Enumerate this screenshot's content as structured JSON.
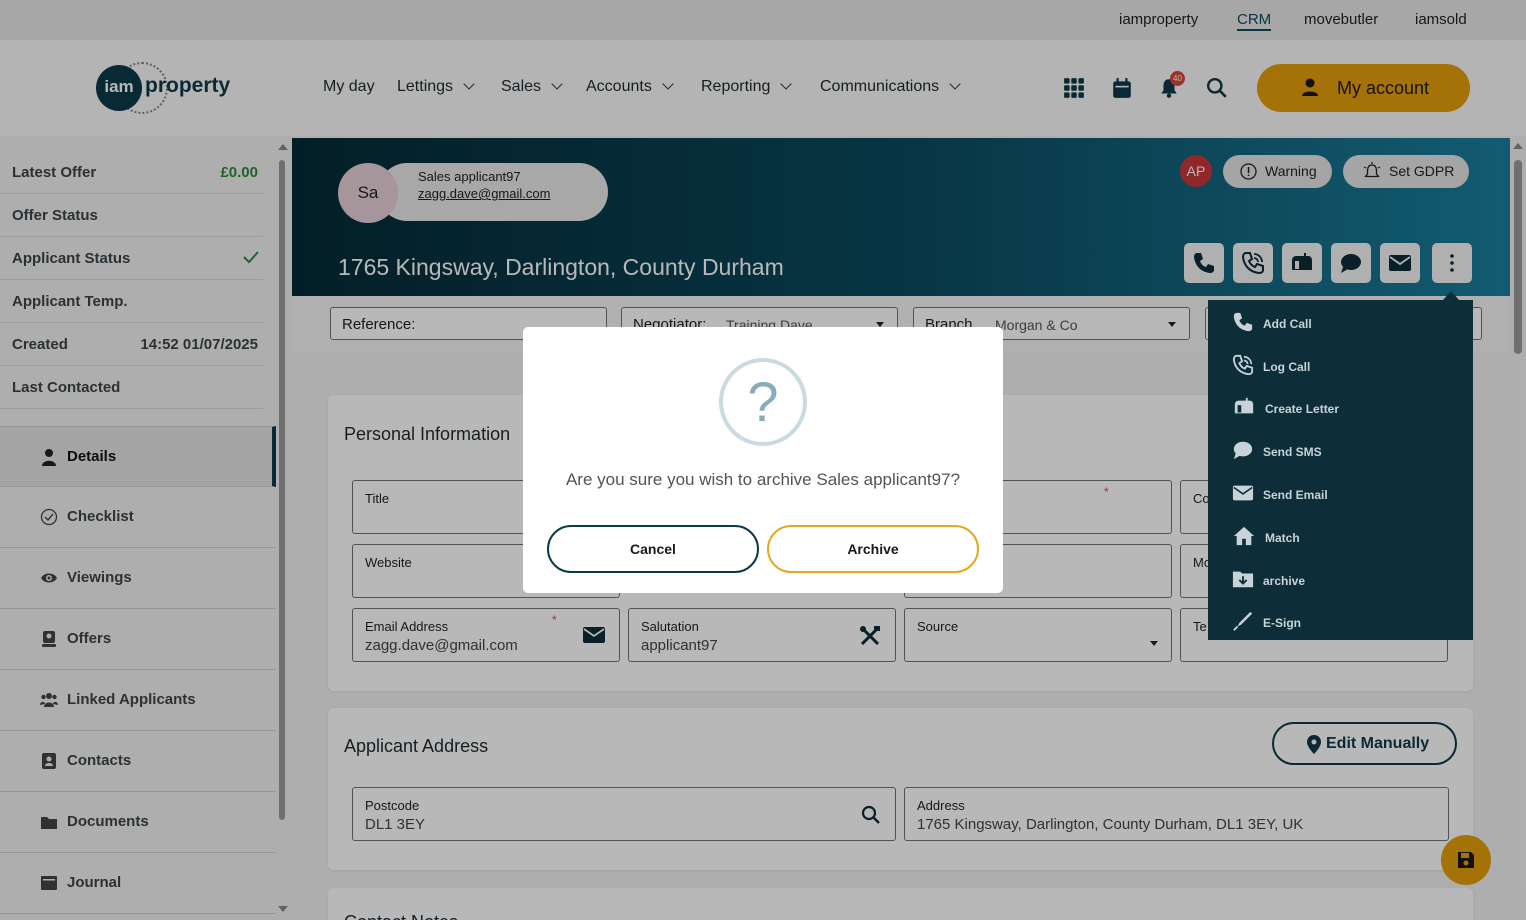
{
  "brandbar": {
    "links": [
      "iamproperty",
      "CRM",
      "movebutler",
      "iamsold"
    ],
    "active": "CRM"
  },
  "nav": {
    "logo_short": "iam",
    "logo_word": "property",
    "menu": [
      "My day",
      "Lettings",
      "Sales",
      "Accounts",
      "Reporting",
      "Communications"
    ],
    "notification_count": "40",
    "my_account_label": "My account",
    "accent_color": "#e39e0b"
  },
  "sidebar": {
    "summary": [
      {
        "label": "Latest Offer",
        "value": "£0.00"
      },
      {
        "label": "Offer Status",
        "value": ""
      },
      {
        "label": "Applicant Status",
        "value": ""
      },
      {
        "label": "Applicant Temp.",
        "value": ""
      },
      {
        "label": "Created",
        "value": "14:52 01/07/2025"
      },
      {
        "label": "Last Contacted",
        "value": ""
      }
    ],
    "tabs": [
      "Details",
      "Checklist",
      "Viewings",
      "Offers",
      "Linked Applicants",
      "Contacts",
      "Documents",
      "Journal"
    ],
    "active_tab": "Details"
  },
  "header": {
    "avatar_initials": "Sa",
    "applicant_name": "Sales applicant97",
    "applicant_email": "zagg.dave@gmail.com",
    "address": "1765 Kingsway, Darlington, County Durham",
    "user_badge": "AP",
    "warning_label": "Warning",
    "gdpr_label": "Set GDPR"
  },
  "filters": {
    "reference_label": "Reference:",
    "negotiator_label": "Negotiator:",
    "negotiator_value": "Training Dave",
    "branch_label": "Branch",
    "branch_value": "Morgan & Co"
  },
  "personal": {
    "title": "Personal Information",
    "fields": {
      "title_label": "Title",
      "website_label": "Website",
      "email_label": "Email Address",
      "email_value": "zagg.dave@gmail.com",
      "salutation_label": "Salutation",
      "salutation_value": "applicant97",
      "source_label": "Source",
      "co_label": "Co",
      "mo_label": "Mo",
      "te_label": "Te"
    }
  },
  "address_card": {
    "title": "Applicant Address",
    "edit_label": "Edit Manually",
    "postcode_label": "Postcode",
    "postcode_value": "DL1 3EY",
    "address_label": "Address",
    "address_value": "1765 Kingsway, Darlington, County Durham, DL1 3EY, UK",
    "next_section_partial": "Contact Notes"
  },
  "modal": {
    "icon_glyph": "?",
    "message": "Are you sure you wish to archive Sales applicant97?",
    "cancel_label": "Cancel",
    "archive_label": "Archive"
  },
  "actions_menu": {
    "items": [
      "Add Call",
      "Log Call",
      "Create Letter",
      "Send SMS",
      "Send Email",
      "Match",
      "archive",
      "E-Sign"
    ]
  }
}
